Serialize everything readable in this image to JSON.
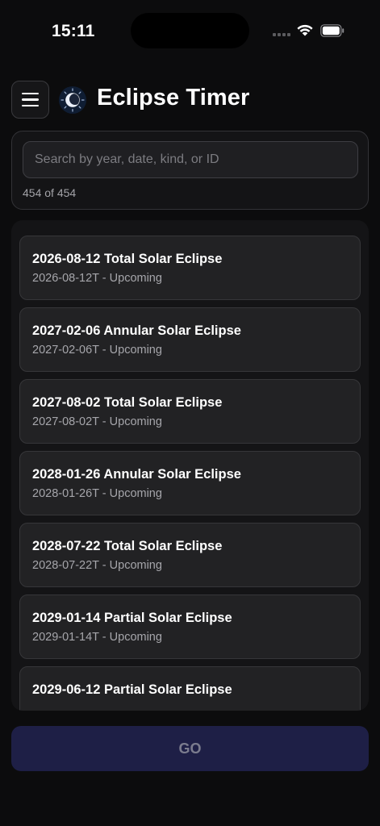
{
  "status_bar": {
    "time": "15:11",
    "signal_icon": "cellular-signal-icon",
    "wifi_icon": "wifi-icon",
    "battery_icon": "battery-icon"
  },
  "header": {
    "title": "Eclipse Timer",
    "menu_icon": "hamburger-menu-icon",
    "logo_icon": "eclipse-logo-icon"
  },
  "search": {
    "placeholder": "Search by year, date, kind, or ID",
    "value": "",
    "count_text": "454 of 454"
  },
  "eclipses": [
    {
      "title": "2026-08-12 Total Solar Eclipse",
      "subtitle": "2026-08-12T - Upcoming"
    },
    {
      "title": "2027-02-06 Annular Solar Eclipse",
      "subtitle": "2027-02-06T - Upcoming"
    },
    {
      "title": "2027-08-02 Total Solar Eclipse",
      "subtitle": "2027-08-02T - Upcoming"
    },
    {
      "title": "2028-01-26 Annular Solar Eclipse",
      "subtitle": "2028-01-26T - Upcoming"
    },
    {
      "title": "2028-07-22 Total Solar Eclipse",
      "subtitle": "2028-07-22T - Upcoming"
    },
    {
      "title": "2029-01-14 Partial Solar Eclipse",
      "subtitle": "2029-01-14T - Upcoming"
    },
    {
      "title": "2029-06-12 Partial Solar Eclipse",
      "subtitle": ""
    }
  ],
  "go_button": {
    "label": "GO"
  },
  "colors": {
    "background": "#0c0c0d",
    "panel": "#141416",
    "card": "#222224",
    "go_button": "#1e1f46",
    "go_text": "#7b7c8e"
  }
}
